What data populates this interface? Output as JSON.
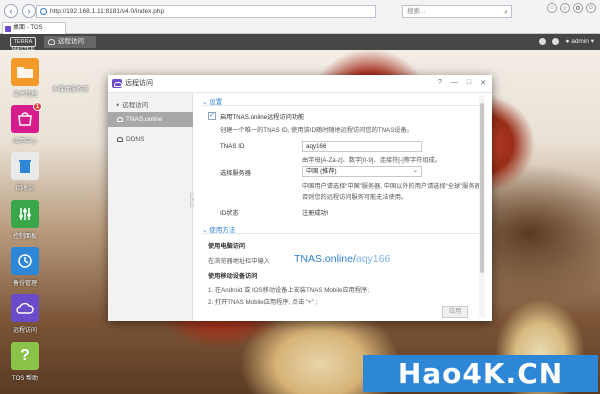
{
  "browser": {
    "url": "http://192.168.1.11:8181/v4.0/index.php",
    "search_placeholder": "搜索...",
    "tab_title": "桌面 - TOS"
  },
  "topbar": {
    "logo": "TERRA MASTER",
    "task_label": "远程访问",
    "user": "admin"
  },
  "desktop_icons": [
    {
      "label": "文件管理",
      "icon": "folder-icon",
      "color": "#f39a2b"
    },
    {
      "label": "应用中心",
      "icon": "bag-icon",
      "color": "#d81b8c",
      "badge": "1"
    },
    {
      "label": "回收站",
      "icon": "trash-icon",
      "color": "#2e86d6"
    },
    {
      "label": "控制面板",
      "icon": "sliders-icon",
      "color": "#3aa64a"
    },
    {
      "label": "备份管理",
      "icon": "clock-icon",
      "color": "#2e86d6"
    },
    {
      "label": "远程访问",
      "icon": "cloud-icon",
      "color": "#6a4bc8"
    },
    {
      "label": "TOS 帮助",
      "icon": "help-icon",
      "color": "#8bc34a"
    }
  ],
  "media_icon_label": "多媒体服务器",
  "dialog": {
    "title": "远程访问",
    "controls": [
      "?",
      "—",
      "□",
      "✕"
    ],
    "sidebar_group": "远程访问",
    "sidebar_items": [
      "TNAS.online",
      "DDNS"
    ],
    "settings_header": "设置",
    "enable_label": "启用TNAS.online远程访问功能",
    "enable_desc": "创建一个唯一的TNAS ID, 使用该ID随时随地远程访问您的TNAS设备。",
    "tnas_id_label": "TNAS ID",
    "tnas_id_value": "aqy166",
    "tnas_id_hint": "由字母[A-Za-z]、数字[0-9]、连接符[-]等字符组成。",
    "server_label": "选择服务器",
    "server_value": "中国 (推荐)",
    "server_hint1": "中国用户请选择“中国”服务器, 中国以外的用户请选择“全球”服务器。",
    "server_hint2": "否则您的远程访问服务可能无法使用。",
    "status_label": "ID状态",
    "status_value": "注册成功!",
    "usage_header": "使用方法",
    "usage_pc_title": "使用电脑访问",
    "usage_pc_desc": "在浏览器地址栏中输入",
    "link_prefix": "TNAS.online/",
    "link_id": "aqy166",
    "usage_mobile_title": "使用移动设备访问",
    "usage_mobile_step1": "1. 在Android 或 IOS移动设备上安装TNAS Mobile应用程序;",
    "usage_mobile_step2": "2. 打开TNAS Mobile应用程序, 点击 “+” ;",
    "apply_label": "应用"
  },
  "watermark": "Hao4K.CN"
}
